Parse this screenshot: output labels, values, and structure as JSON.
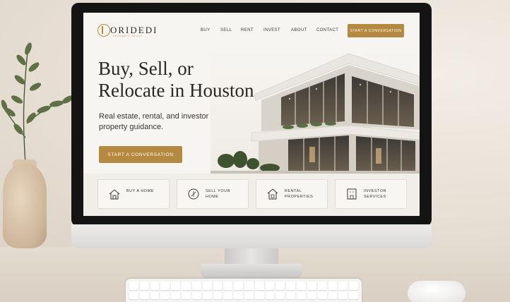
{
  "brand": {
    "name": "ORIDEDI",
    "tagline": "PROPERTY GROUP",
    "accent": "#b5893f"
  },
  "nav": {
    "items": [
      "BUY",
      "SELL",
      "RENT",
      "INVEST",
      "ABOUT",
      "CONTACT"
    ],
    "cta_label": "START A CONVERSATION"
  },
  "hero": {
    "title_line1": "Buy, Sell, or",
    "title_line2": "Relocate in Houston",
    "subtitle_line1": "Real estate, rental, and investor",
    "subtitle_line2": "property guidance.",
    "cta_label": "START A CONVERSATION"
  },
  "services": [
    {
      "label_line1": "BUY A HOME",
      "label_line2": "",
      "icon": "house-icon"
    },
    {
      "label_line1": "SELL YOUR",
      "label_line2": "HOME",
      "icon": "tag-icon"
    },
    {
      "label_line1": "RENTAL",
      "label_line2": "PROPERTIES",
      "icon": "rental-icon"
    },
    {
      "label_line1": "INVESTOR",
      "label_line2": "SERVICES",
      "icon": "building-icon"
    }
  ]
}
